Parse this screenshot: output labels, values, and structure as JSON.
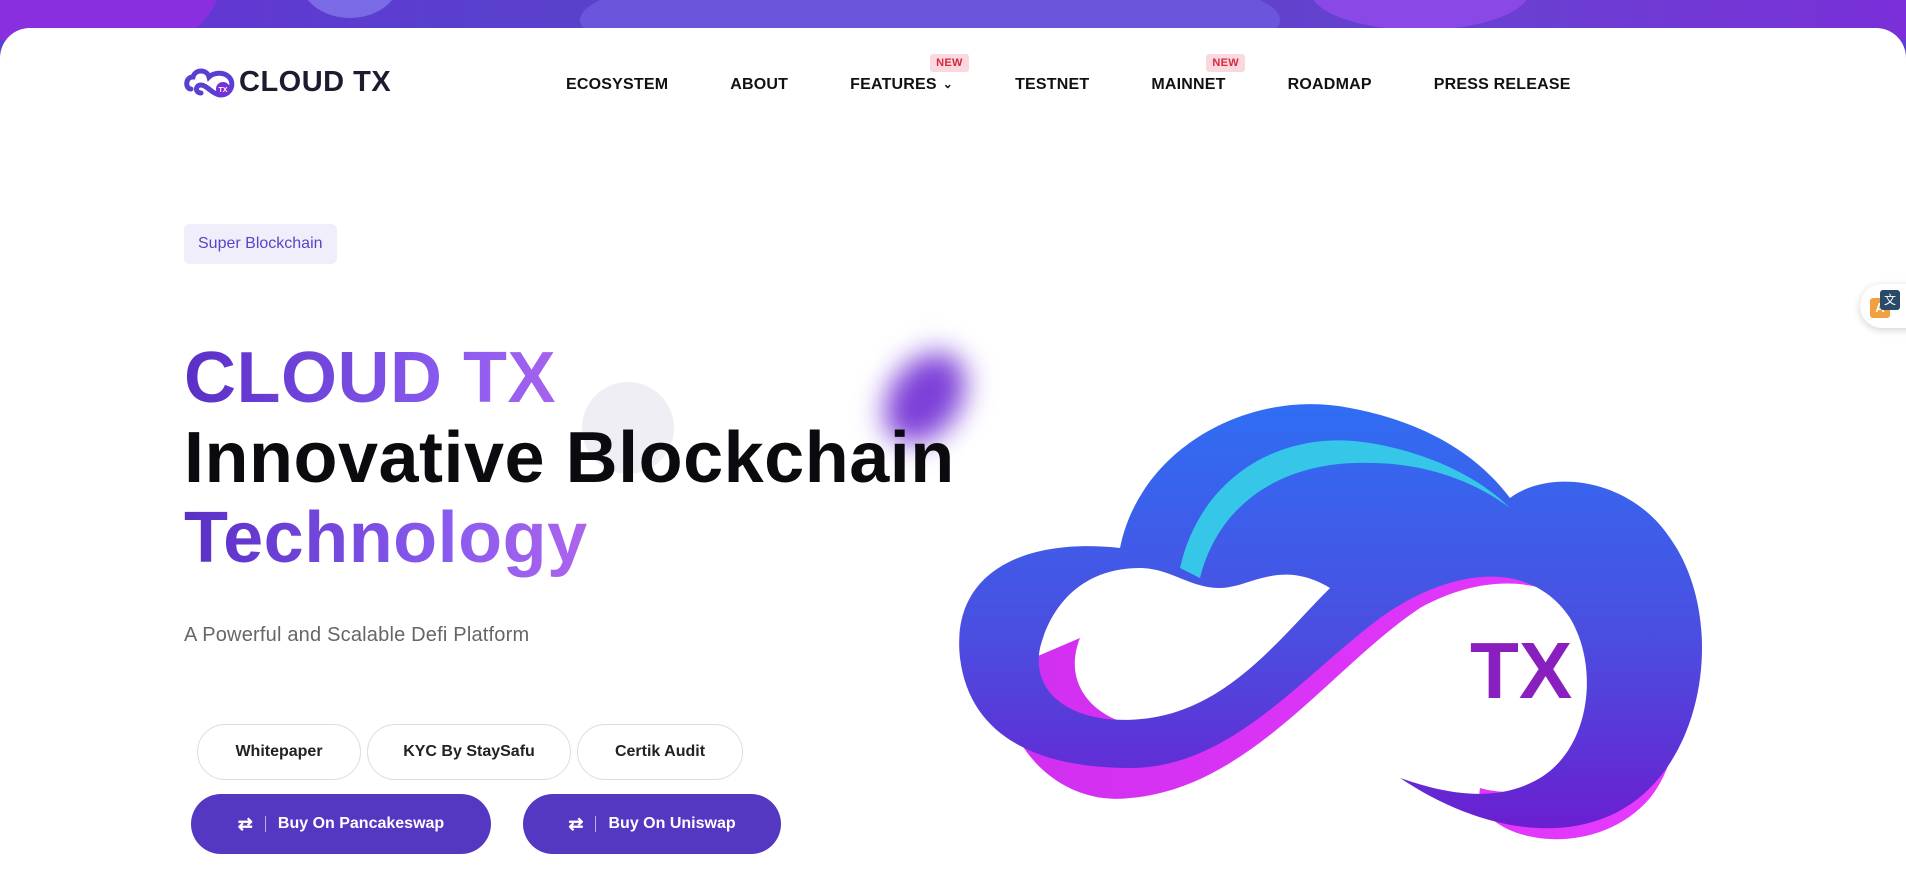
{
  "brand": {
    "name": "CLOUD TX",
    "logo_mark_text": "TX"
  },
  "nav": {
    "items": [
      {
        "label": "ECOSYSTEM"
      },
      {
        "label": "ABOUT"
      },
      {
        "label": "FEATURES",
        "badge": "NEW",
        "has_dropdown": true
      },
      {
        "label": "TESTNET"
      },
      {
        "label": "MAINNET",
        "badge": "NEW"
      },
      {
        "label": "ROADMAP"
      },
      {
        "label": "PRESS RELEASE"
      }
    ]
  },
  "hero": {
    "tag": "Super Blockchain",
    "title_line1": "CLOUD TX",
    "title_line2": "Innovative Blockchain",
    "title_line3": "Technology",
    "subtitle": "A Powerful and Scalable Defi Platform",
    "links": [
      {
        "label": "Whitepaper"
      },
      {
        "label": "KYC By StaySafu"
      },
      {
        "label": "Certik Audit"
      }
    ],
    "buy_buttons": [
      {
        "label": "Buy On Pancakeswap"
      },
      {
        "label": "Buy On Uniswap"
      }
    ],
    "art_text": "TX"
  },
  "colors": {
    "accent": "#5438c2",
    "badge_bg": "#f9d9df",
    "badge_text": "#d7283d",
    "tag_bg": "#f1eefc"
  }
}
